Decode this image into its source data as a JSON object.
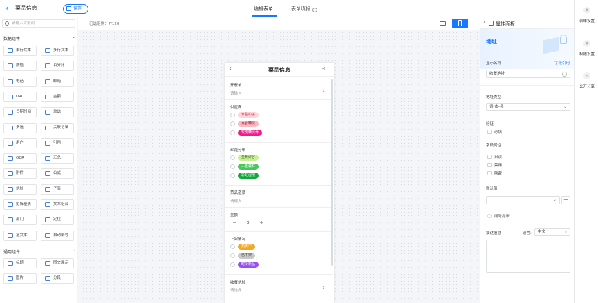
{
  "header": {
    "back_icon": "‹",
    "app_title": "菜品信息",
    "save_label": "保存",
    "tabs": [
      {
        "label": "编辑表单",
        "active": true
      },
      {
        "label": "表单填报",
        "active": false
      }
    ],
    "help_icon": "?"
  },
  "left": {
    "search_placeholder": "请输入关键词",
    "groups": [
      {
        "title": "数据组件",
        "items": [
          {
            "label": "单行文本",
            "icon": "single-line-text-icon"
          },
          {
            "label": "多行文本",
            "icon": "multi-line-text-icon"
          },
          {
            "label": "数值",
            "icon": "number-icon"
          },
          {
            "label": "百分比",
            "icon": "percent-icon"
          },
          {
            "label": "电话",
            "icon": "phone-icon"
          },
          {
            "label": "邮箱",
            "icon": "email-icon"
          },
          {
            "label": "URL",
            "icon": "link-icon"
          },
          {
            "label": "金额",
            "icon": "money-icon"
          },
          {
            "label": "日期时间",
            "icon": "calendar-icon"
          },
          {
            "label": "单选",
            "icon": "radio-icon"
          },
          {
            "label": "多选",
            "icon": "checkbox-icon"
          },
          {
            "label": "关联记录",
            "icon": "relation-icon"
          },
          {
            "label": "用户",
            "icon": "user-icon"
          },
          {
            "label": "引用",
            "icon": "quote-icon"
          },
          {
            "label": "OCR",
            "icon": "ocr-icon"
          },
          {
            "label": "汇总",
            "icon": "sum-icon"
          },
          {
            "label": "附件",
            "icon": "attachment-icon"
          },
          {
            "label": "公式",
            "icon": "formula-icon"
          },
          {
            "label": "地址",
            "icon": "location-icon"
          },
          {
            "label": "子表",
            "icon": "subtable-icon"
          },
          {
            "label": "矩阵量表",
            "icon": "matrix-icon"
          },
          {
            "label": "文本组合",
            "icon": "text-combine-icon"
          },
          {
            "label": "部门",
            "icon": "department-icon"
          },
          {
            "label": "定位",
            "icon": "position-icon"
          },
          {
            "label": "富文本",
            "icon": "rich-text-icon"
          },
          {
            "label": "自动编号",
            "icon": "auto-number-icon"
          }
        ]
      },
      {
        "title": "通用组件",
        "items": [
          {
            "label": "标题",
            "icon": "heading-icon"
          },
          {
            "label": "图文展示",
            "icon": "image-text-icon"
          },
          {
            "label": "图片",
            "icon": "image-icon"
          },
          {
            "label": "分段",
            "icon": "section-icon"
          }
        ]
      }
    ]
  },
  "canvas": {
    "selected_count": "已选组件：7/120",
    "phone_title": "菜品信息",
    "fields": [
      {
        "label": "开餐单",
        "placeholder": "请输入"
      },
      {
        "label": "供应商",
        "options": [
          {
            "text": "水晶心子",
            "bg": "#ffd4d9",
            "fg": "#b8303f"
          },
          {
            "text": "百合精灵",
            "bg": "#fbb8c3",
            "fg": "#8a1e2e"
          },
          {
            "text": "玫瑰精灵骨",
            "bg": "#f01c8c",
            "fg": "#ffffff"
          }
        ]
      },
      {
        "label": "珍馐分布",
        "options": [
          {
            "text": "金黄碎谷",
            "bg": "#c8ef95",
            "fg": "#3f6b10"
          },
          {
            "text": "人鱼森林",
            "bg": "#44c85a",
            "fg": "#ffffff"
          },
          {
            "text": "彩虹湿地",
            "bg": "#14a83a",
            "fg": "#ffffff"
          }
        ]
      },
      {
        "label": "菜品道菜",
        "placeholder": "请输入"
      },
      {
        "label": "金额",
        "stepper_value": "0"
      },
      {
        "label": "上架情况",
        "options": [
          {
            "text": "热卖中",
            "bg": "#f5a623",
            "fg": "#ffffff"
          },
          {
            "text": "已下架",
            "bg": "#c9c9c9",
            "fg": "#444444"
          },
          {
            "text": "时令新品",
            "bg": "#9b4ff2",
            "fg": "#ffffff"
          }
        ]
      },
      {
        "label": "收餐地址",
        "placeholder": "请选择"
      }
    ]
  },
  "right": {
    "panel_title": "属性面板",
    "component_name": "地址",
    "display_name_label": "显示名称",
    "field_ref_link": "字段引用",
    "display_name_value": "收餐地址",
    "address_type_label": "地址类型",
    "address_type_value": "省-市-县",
    "validate_label": "验证",
    "required_label": "必填",
    "field_attr_label": "字段属性",
    "attrs": [
      "只读",
      "禁用",
      "隐藏"
    ],
    "default_label": "默认值",
    "hint_label": "问号提示",
    "desc_label": "描述信息",
    "lang_label": "语言:",
    "lang_value": "中文"
  },
  "rail": {
    "items": [
      {
        "label": "表单设置",
        "icon": "form-settings-icon"
      },
      {
        "label": "权限设置",
        "icon": "permission-icon"
      },
      {
        "label": "公开分享",
        "icon": "share-icon"
      }
    ]
  },
  "colors": {
    "accent": "#1677ff"
  }
}
